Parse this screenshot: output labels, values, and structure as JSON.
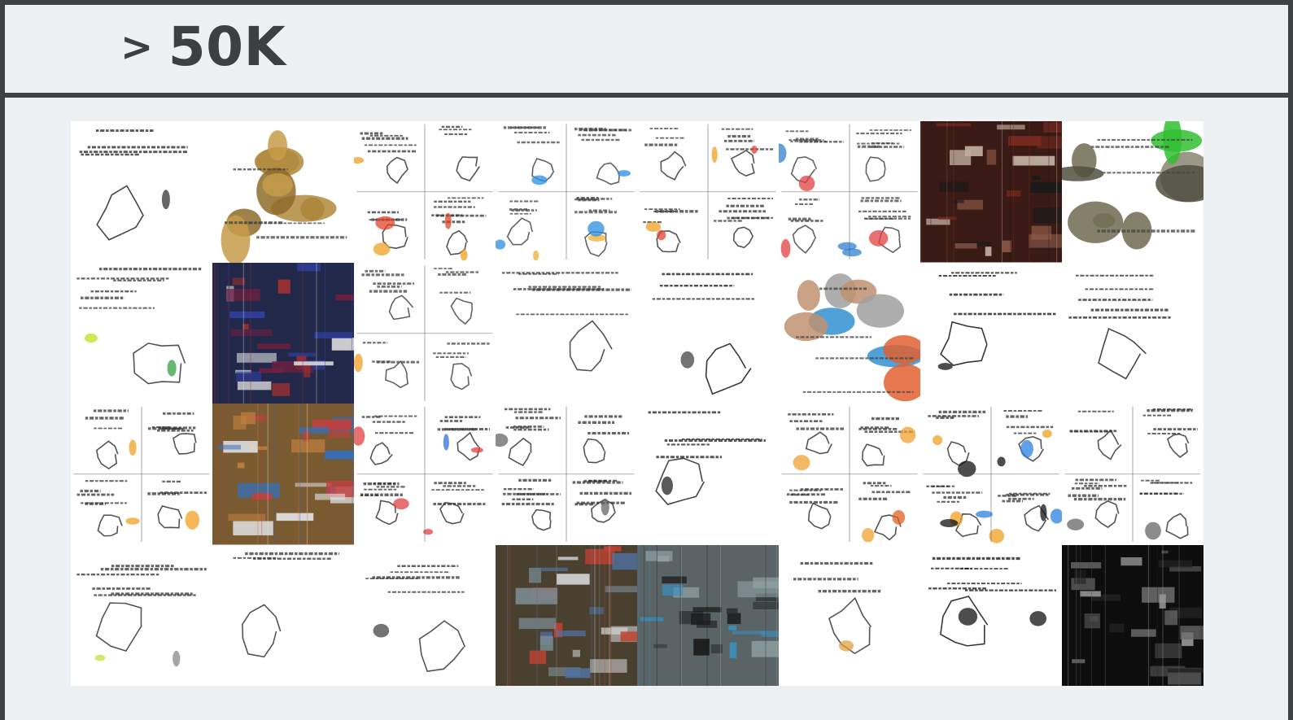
{
  "header": {
    "comparator": ">",
    "value": "50K"
  },
  "grid": {
    "rows": 4,
    "columns": 8,
    "tiles": [
      {
        "style": "sketch",
        "ink": "#222222",
        "accents": [
          "#333333"
        ]
      },
      {
        "style": "blotch",
        "bg": "#ffffff",
        "colors": [
          "#b08a3c",
          "#8e6b2a",
          "#c79b4a"
        ]
      },
      {
        "style": "quad-sketch",
        "ink": "#333333",
        "accents": [
          "#e0462b",
          "#f0a020",
          "#d040c0"
        ]
      },
      {
        "style": "quad-sketch",
        "ink": "#444444",
        "accents": [
          "#f0b030",
          "#2a8ee0"
        ]
      },
      {
        "style": "quad-sketch",
        "ink": "#333333",
        "accents": [
          "#f0a020",
          "#e04030"
        ]
      },
      {
        "style": "quad-sketch",
        "ink": "#444444",
        "accents": [
          "#e04040",
          "#3080d0"
        ]
      },
      {
        "style": "dark",
        "bg": "#3a1a14",
        "colors": [
          "#7a2a20",
          "#1a1a1a",
          "#8c5a4a",
          "#c0b0a0"
        ]
      },
      {
        "style": "blotch",
        "bg": "#ffffff",
        "colors": [
          "#6f6a50",
          "#505040",
          "#30c030",
          "#8a8470"
        ]
      },
      {
        "style": "sketch",
        "ink": "#333333",
        "accents": [
          "#c0e020",
          "#30a040"
        ]
      },
      {
        "style": "dark",
        "bg": "#22284a",
        "colors": [
          "#a03030",
          "#3040a0",
          "#e0e0e0",
          "#702040"
        ]
      },
      {
        "style": "quad-sketch",
        "ink": "#444444",
        "accents": [
          "#f0a020"
        ]
      },
      {
        "style": "sketch",
        "ink": "#333333",
        "accents": [
          "#e06020",
          "#c09040",
          "#803010"
        ]
      },
      {
        "style": "sketch",
        "ink": "#111111",
        "accents": [
          "#111111",
          "#444444"
        ]
      },
      {
        "style": "blotch",
        "bg": "#ffffff",
        "colors": [
          "#c09070",
          "#3090d0",
          "#e06030",
          "#a0a0a0"
        ]
      },
      {
        "style": "sketch",
        "ink": "#111111",
        "accents": [
          "#111111",
          "#777777"
        ]
      },
      {
        "style": "sketch",
        "ink": "#222222",
        "accents": [
          "#111111",
          "#ff6020"
        ]
      },
      {
        "style": "quad-sketch",
        "ink": "#333333",
        "accents": [
          "#f0a020"
        ]
      },
      {
        "style": "dark",
        "bg": "#7a5a30",
        "colors": [
          "#c08040",
          "#3070c0",
          "#e0e0e0",
          "#c04040"
        ]
      },
      {
        "style": "quad-sketch",
        "ink": "#333333",
        "accents": [
          "#e04040",
          "#3070e0"
        ]
      },
      {
        "style": "quad-sketch",
        "ink": "#333333",
        "accents": [
          "#666666"
        ]
      },
      {
        "style": "sketch",
        "ink": "#222222",
        "accents": [
          "#222222"
        ]
      },
      {
        "style": "quad-sketch",
        "ink": "#333333",
        "accents": [
          "#f0a030",
          "#e06020"
        ]
      },
      {
        "style": "quad-sketch",
        "ink": "#333333",
        "accents": [
          "#f0a020",
          "#2a80e0",
          "#111111"
        ]
      },
      {
        "style": "quad-sketch",
        "ink": "#333333",
        "accents": [
          "#666666"
        ]
      },
      {
        "style": "sketch",
        "ink": "#333333",
        "accents": [
          "#c0e040",
          "#555555",
          "#888888"
        ]
      },
      {
        "style": "sketch",
        "ink": "#333333",
        "accents": [
          "#444444"
        ]
      },
      {
        "style": "sketch",
        "ink": "#333333",
        "accents": [
          "#444444"
        ]
      },
      {
        "style": "dark",
        "bg": "#4a4030",
        "colors": [
          "#7a8a90",
          "#c04030",
          "#5070a0",
          "#d0d0d0"
        ]
      },
      {
        "style": "dark",
        "bg": "#5a6466",
        "colors": [
          "#2a3234",
          "#90a0a4",
          "#3a90c0",
          "#1a1a1a"
        ]
      },
      {
        "style": "sketch",
        "ink": "#333333",
        "accents": [
          "#e0a040"
        ]
      },
      {
        "style": "sketch",
        "ink": "#111111",
        "accents": [
          "#111111",
          "#111111"
        ]
      },
      {
        "style": "dark",
        "bg": "#0d0d0d",
        "colors": [
          "#6a6a6a",
          "#9a9a9a",
          "#4a4a4a",
          "#222222"
        ]
      }
    ]
  }
}
